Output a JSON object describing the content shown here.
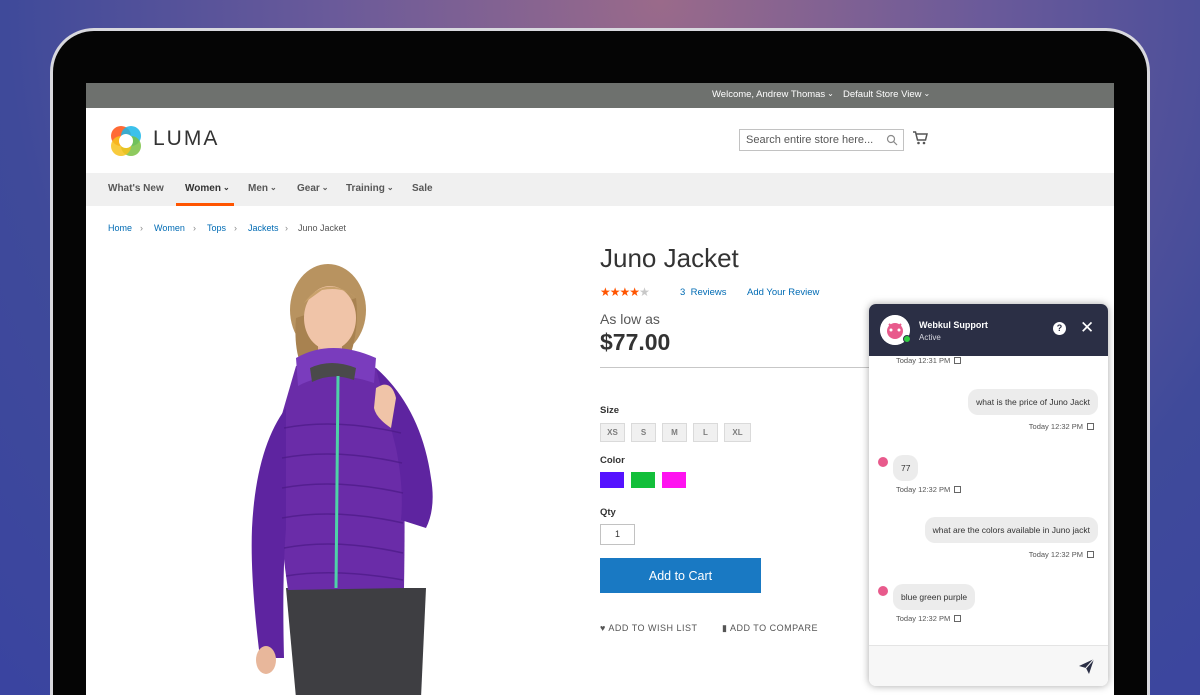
{
  "topbar": {
    "welcome": "Welcome, Andrew Thomas",
    "store": "Default Store View"
  },
  "header": {
    "logo_text": "LUMA",
    "search_placeholder": "Search entire store here..."
  },
  "nav": {
    "items": [
      {
        "label": "What's New"
      },
      {
        "label": "Women",
        "active": true
      },
      {
        "label": "Men"
      },
      {
        "label": "Gear"
      },
      {
        "label": "Training"
      },
      {
        "label": "Sale"
      }
    ]
  },
  "breadcrumbs": [
    "Home",
    "Women",
    "Tops",
    "Jackets",
    "Juno Jacket"
  ],
  "product": {
    "title": "Juno Jacket",
    "rating": 4.5,
    "rating_max": 5,
    "reviews_count": "3",
    "reviews_label": "Reviews",
    "add_review": "Add Your Review",
    "as_low_as": "As low as",
    "price": "$77.00",
    "size_label": "Size",
    "sizes": [
      "XS",
      "S",
      "M",
      "L",
      "XL"
    ],
    "color_label": "Color",
    "colors": [
      "#5512ff",
      "#12bf3a",
      "#ff12f0"
    ],
    "qty_label": "Qty",
    "qty": "1",
    "add_to_cart": "Add to Cart",
    "wish_list": "ADD TO WISH LIST",
    "compare": "ADD TO COMPARE"
  },
  "chat": {
    "agent_name": "Webkul Support",
    "agent_status": "Active",
    "messages": [
      {
        "from": "bot",
        "text": "",
        "time": "Today 12:31 PM"
      },
      {
        "from": "user",
        "text": "what is the price of Juno Jackt",
        "time": "Today 12:32 PM"
      },
      {
        "from": "bot",
        "text": "77",
        "time": "Today 12:32 PM"
      },
      {
        "from": "user",
        "text": "what are the colors available in Juno jackt",
        "time": "Today 12:32 PM"
      },
      {
        "from": "bot",
        "text": "blue green purple",
        "time": "Today 12:32 PM"
      }
    ],
    "input_value": ""
  },
  "colors": {
    "accent": "#ff5501",
    "link": "#006bb4",
    "button": "#1979c3",
    "chat_header": "#2b2f45"
  }
}
